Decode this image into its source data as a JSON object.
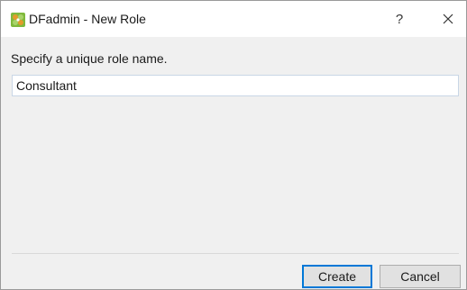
{
  "window": {
    "title": "DFadmin - New Role",
    "app_icon": "dfadmin-app-icon",
    "help_label": "?",
    "close_icon": "close-icon"
  },
  "form": {
    "prompt": "Specify a unique role name.",
    "role_name_value": "Consultant"
  },
  "buttons": {
    "create_label": "Create",
    "cancel_label": "Cancel"
  },
  "colors": {
    "dialog_background": "#f0f0f0",
    "titlebar_background": "#ffffff",
    "input_border": "#c9d6e6",
    "default_button_border": "#0078d7",
    "icon_green": "#7fb93c",
    "icon_orange": "#e39b2b"
  }
}
